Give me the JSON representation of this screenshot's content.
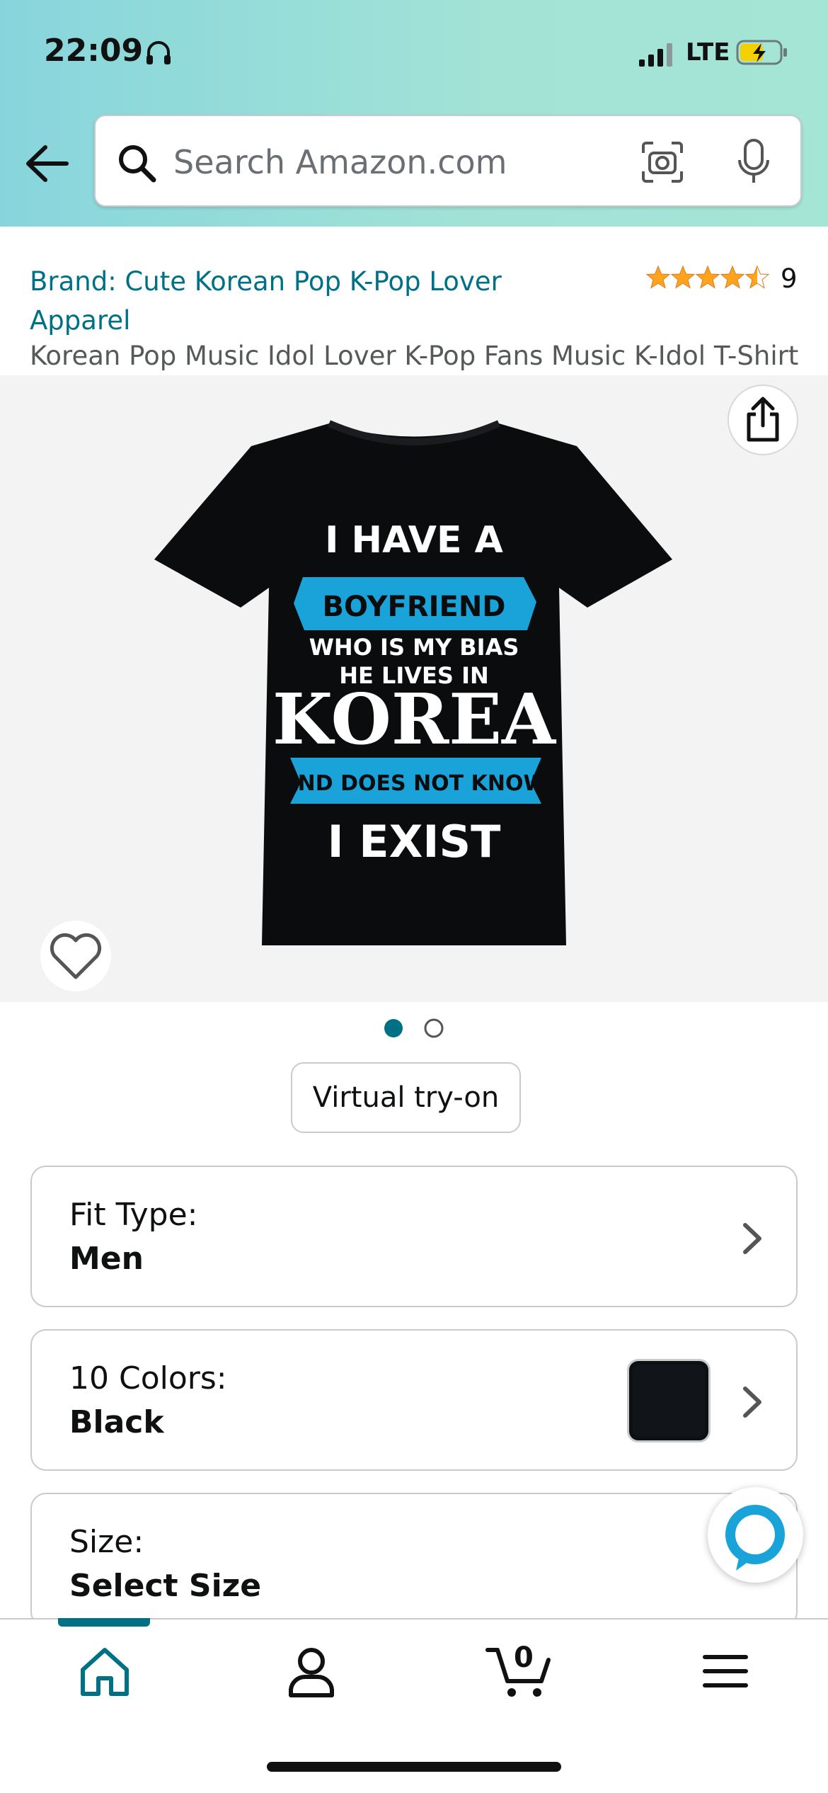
{
  "status_bar": {
    "time": "22:09",
    "network": "LTE"
  },
  "search": {
    "placeholder": "Search Amazon.com"
  },
  "product": {
    "brand": "Brand: Cute Korean Pop K-Pop Lover Apparel",
    "rating_value": 4.5,
    "rating_count": "9",
    "title": "Korean Pop Music Idol Lover K-Pop Fans Music K-Idol T-Shirt",
    "image_count": 2,
    "active_image_index": 0,
    "shirt_print": {
      "line1": "I HAVE A",
      "line2": "BOYFRIEND",
      "line3": "WHO IS MY BIAS",
      "line4": "HE LIVES IN",
      "line5": "KOREA",
      "line6": "AND DOES NOT KNOW",
      "line7": "I EXIST"
    }
  },
  "actions": {
    "virtual_tryon": "Virtual try-on"
  },
  "options": {
    "fit": {
      "label": "Fit Type:",
      "value": "Men"
    },
    "color": {
      "label": "10 Colors:",
      "value": "Black",
      "swatch": "#0d0f12"
    },
    "size": {
      "label": "Size:",
      "value": "Select Size"
    }
  },
  "cart": {
    "count": "0"
  },
  "colors": {
    "link": "#007185",
    "star": "#ffa41c",
    "accent_blue": "#1aa3d8"
  },
  "icons": [
    "back-arrow-icon",
    "search-icon",
    "camera-icon",
    "mic-icon",
    "share-icon",
    "heart-icon",
    "chevron-right-icon",
    "alexa-icon",
    "home-icon",
    "account-icon",
    "cart-icon",
    "menu-icon",
    "headphones-icon",
    "signal-icon",
    "battery-icon"
  ]
}
